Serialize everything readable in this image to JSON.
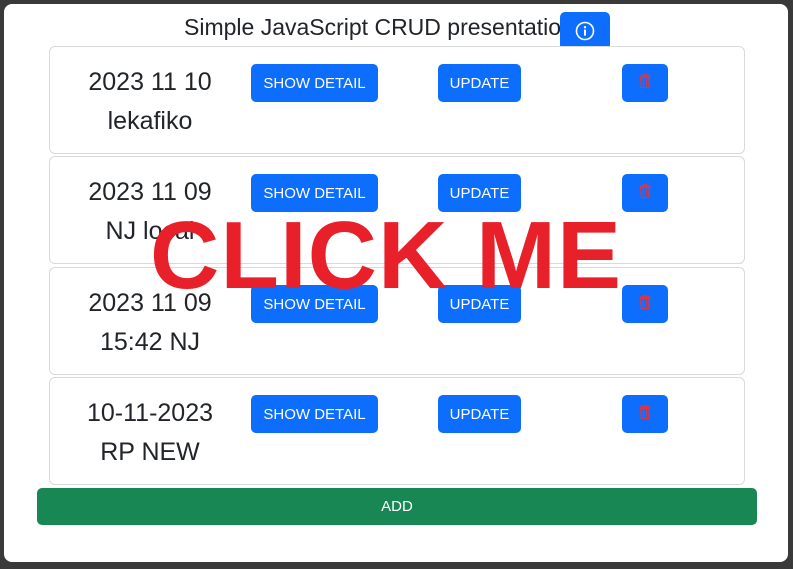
{
  "header": {
    "title": "Simple JavaScript CRUD presentation.",
    "info_icon": "info-circle-icon"
  },
  "records": [
    {
      "line1": "2023 11 10",
      "line2": "lekafiko",
      "detail_label": "SHOW DETAIL",
      "update_label": "UPDATE",
      "delete_icon": "trash-icon"
    },
    {
      "line1": "2023 11 09",
      "line2": "NJ local",
      "detail_label": "SHOW DETAIL",
      "update_label": "UPDATE",
      "delete_icon": "trash-icon"
    },
    {
      "line1": "2023 11 09",
      "line2": "15:42 NJ",
      "detail_label": "SHOW DETAIL",
      "update_label": "UPDATE",
      "delete_icon": "trash-icon"
    },
    {
      "line1": "10-11-2023",
      "line2": "RP NEW",
      "detail_label": "SHOW DETAIL",
      "update_label": "UPDATE",
      "delete_icon": "trash-icon"
    }
  ],
  "add_label": "ADD",
  "overlay_text": "CLICK ME",
  "colors": {
    "primary": "#0d6efd",
    "success": "#198754",
    "danger": "#dc3545",
    "overlay": "#e8202a",
    "backdrop": "#3a3a3a"
  }
}
